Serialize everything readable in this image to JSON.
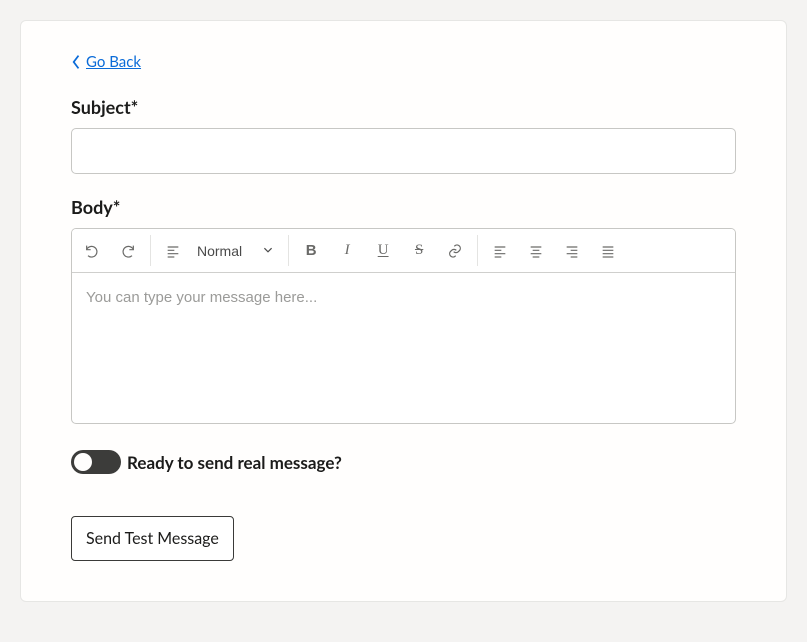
{
  "nav": {
    "go_back": "Go Back"
  },
  "form": {
    "subject_label": "Subject*",
    "subject_value": "",
    "body_label": "Body*"
  },
  "editor": {
    "heading_value": "Normal",
    "placeholder": "You can type your message here..."
  },
  "toggle": {
    "label": "Ready to send real message?",
    "on": false
  },
  "actions": {
    "send_test": "Send Test Message"
  }
}
